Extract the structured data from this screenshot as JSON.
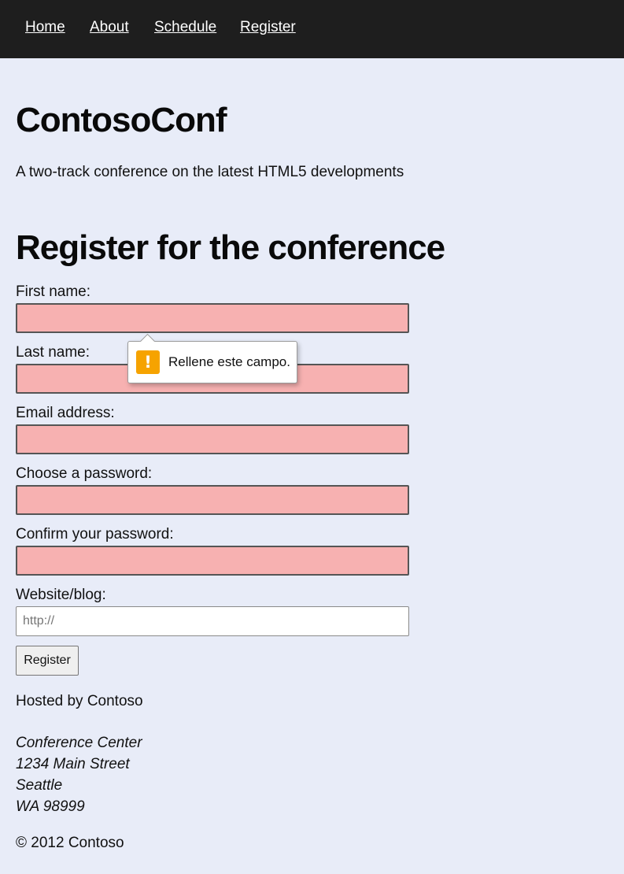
{
  "nav": {
    "items": [
      "Home",
      "About",
      "Schedule",
      "Register"
    ]
  },
  "header": {
    "title": "ContosoConf",
    "subtitle": "A two-track conference on the latest HTML5 developments"
  },
  "form": {
    "heading": "Register for the conference",
    "fields": [
      {
        "label": "First name:",
        "value": "",
        "invalid": true
      },
      {
        "label": "Last name:",
        "value": "",
        "invalid": true
      },
      {
        "label": "Email address:",
        "value": "",
        "invalid": true
      },
      {
        "label": "Choose a password:",
        "value": "",
        "invalid": true
      },
      {
        "label": "Confirm your password:",
        "value": "",
        "invalid": true
      },
      {
        "label": "Website/blog:",
        "value": "",
        "placeholder": "http://",
        "invalid": false
      }
    ],
    "submit_label": "Register",
    "validation_tooltip": {
      "icon": "warning-icon",
      "text": "Rellene este campo."
    }
  },
  "footer": {
    "hosted": "Hosted by Contoso",
    "address": [
      "Conference Center",
      "1234 Main Street",
      "Seattle",
      "WA 98999"
    ],
    "copyright": "© 2012 Contoso"
  },
  "colors": {
    "nav_background": "#1e1e1e",
    "page_background": "#e8ecf8",
    "invalid_field": "#f7b1b1",
    "warning": "#f6a300"
  }
}
